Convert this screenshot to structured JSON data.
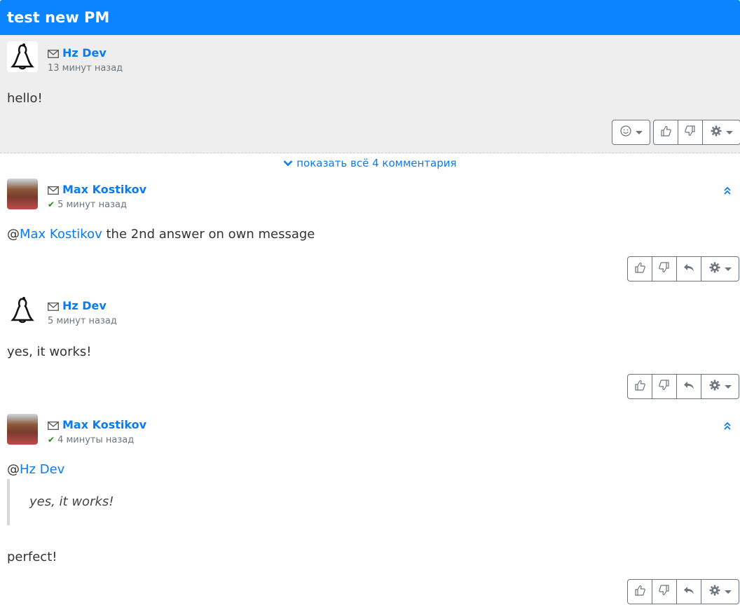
{
  "header": {
    "title": "test new PM"
  },
  "main_post": {
    "author": "Hz Dev",
    "time": "13 минут назад",
    "text": "hello!"
  },
  "show_all": "показать всё 4 комментария",
  "comments": [
    {
      "author": "Max Kostikov",
      "time": "5 минут назад",
      "mention": "Max Kostikov",
      "text": " the 2nd answer on own message"
    },
    {
      "author": "Hz Dev",
      "time": "5 минут назад",
      "text": "yes, it works!"
    },
    {
      "author": "Max Kostikov",
      "time": "4 минуты назад",
      "mention": "Hz Dev",
      "quote": "yes, it works!",
      "text": "perfect!"
    }
  ],
  "colors": {
    "header_bg": "#0a84ff",
    "link": "#0a7cf0",
    "main_bg": "#eeeeee",
    "check": "#1e8b1e"
  }
}
